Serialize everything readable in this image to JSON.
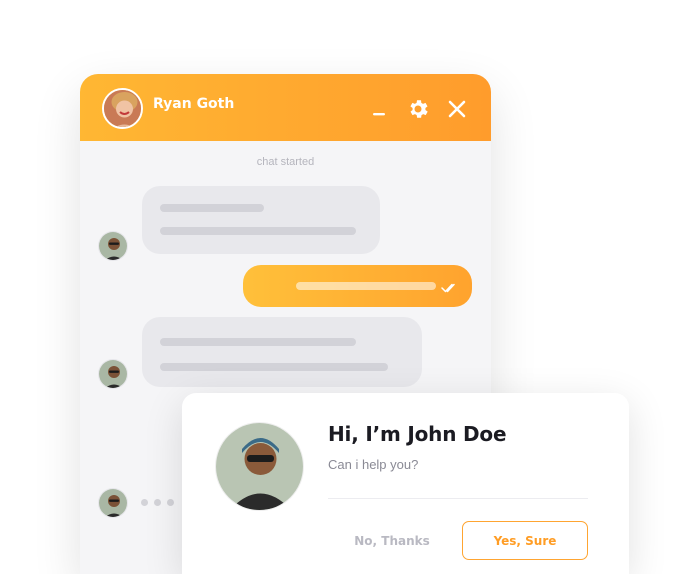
{
  "chat": {
    "contact_name": "Ryan Goth",
    "status_text": "chat started",
    "icons": {
      "minimize": "minimize-icon",
      "settings": "gear-icon",
      "close": "close-icon",
      "read": "double-check-icon"
    }
  },
  "popup": {
    "title": "Hi, I’m John Doe",
    "subtitle": "Can i help you?",
    "decline_label": "No, Thanks",
    "accept_label": "Yes, Sure"
  },
  "colors": {
    "accent": "#ffa32e",
    "accent_light": "#ffc03a",
    "bubble_incoming": "#e8e8ec",
    "text_dark": "#1b1b22"
  }
}
